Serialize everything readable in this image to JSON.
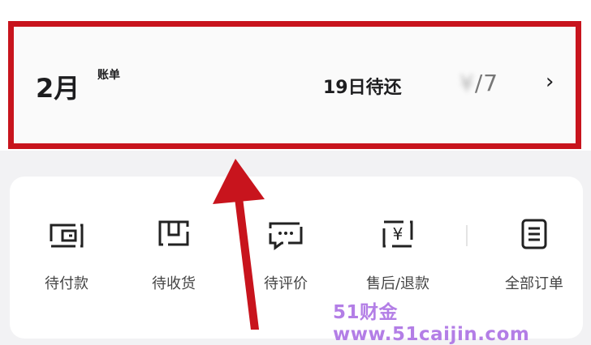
{
  "bill": {
    "month": "2月",
    "month_suffix": "账单",
    "due_text": "19日待还",
    "amount_hidden": "¥",
    "amount_visible": "/7"
  },
  "orders": {
    "items": [
      {
        "label": "待付款",
        "icon": "wallet-icon"
      },
      {
        "label": "待收货",
        "icon": "package-icon"
      },
      {
        "label": "待评价",
        "icon": "comment-icon"
      },
      {
        "label": "售后/退款",
        "icon": "refund-icon"
      },
      {
        "label": "全部订单",
        "icon": "order-list-icon"
      }
    ]
  },
  "watermark": "51财金www.51caijin.com",
  "colors": {
    "highlight_border": "#c8141d",
    "arrow": "#c8141d",
    "watermark": "#b37ee6"
  }
}
